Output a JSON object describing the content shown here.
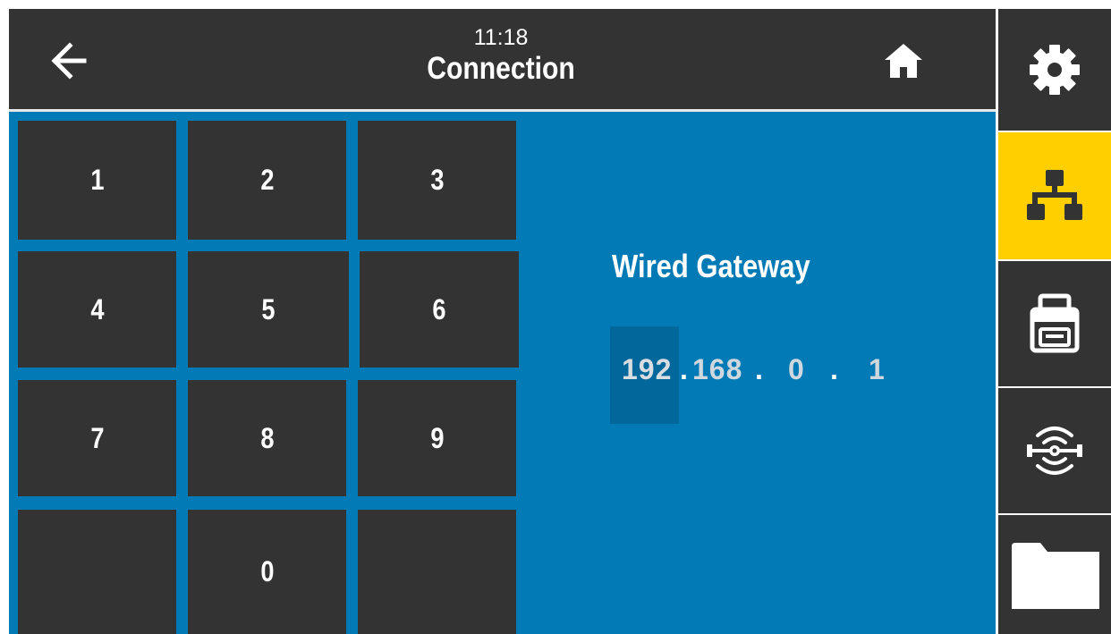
{
  "header": {
    "time": "11:18",
    "title": "Connection",
    "back_icon": "back-arrow-icon",
    "home_icon": "home-icon"
  },
  "keypad": {
    "keys": [
      "1",
      "2",
      "3",
      "4",
      "5",
      "6",
      "7",
      "8",
      "9",
      "",
      "0",
      ""
    ]
  },
  "panel": {
    "title": "Wired Gateway",
    "ip": [
      "192",
      "168",
      "0",
      "1"
    ],
    "separator": ".",
    "selected_segment": "192"
  },
  "sidebar": {
    "items": [
      {
        "icon": "gear-icon",
        "active": false
      },
      {
        "icon": "network-icon",
        "active": true
      },
      {
        "icon": "printer-icon",
        "active": false
      },
      {
        "icon": "rfid-antenna-icon",
        "active": false
      },
      {
        "icon": "folder-icon",
        "active": false
      }
    ]
  },
  "colors": {
    "content_bg": "#027ab5",
    "header_bg": "#333333",
    "key_bg": "#333333",
    "active_accent": "#ffcf00",
    "selected_segment_bg": "#02679b"
  }
}
